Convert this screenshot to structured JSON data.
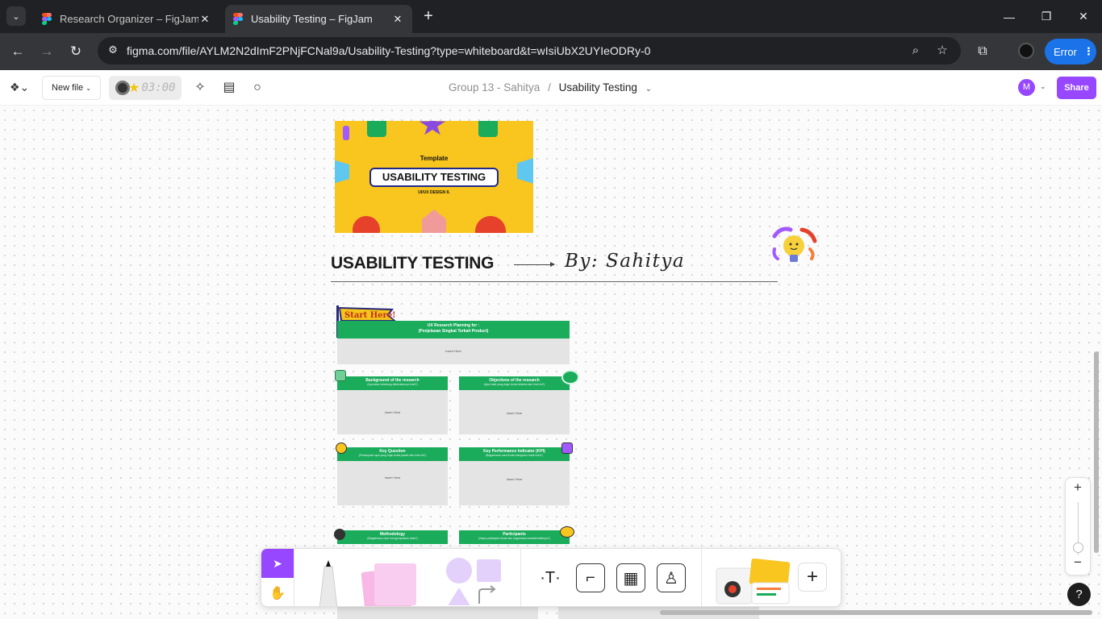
{
  "browser": {
    "tabs": [
      {
        "title": "Research Organizer – FigJam",
        "active": false
      },
      {
        "title": "Usability Testing – FigJam",
        "active": true
      }
    ],
    "url": "figma.com/file/AYLM2N2dImF2PNjFCNal9a/Usability-Testing?type=whiteboard&t=wIsiUbX2UYIeODRy-0",
    "error_label": "Error"
  },
  "header": {
    "new_file_label": "New file",
    "timer": "03:00",
    "team": "Group 13 - Sahitya",
    "separator": "/",
    "file_name": "Usability Testing",
    "user_initial": "M",
    "share_label": "Share"
  },
  "board": {
    "cover": {
      "template_label": "Template",
      "title": "USABILITY TESTING",
      "subtitle": "UI/UX DESIGN II."
    },
    "heading": "USABILITY TESTING",
    "byline": "By: Sahitya",
    "flag_label": "Start Here!",
    "planning": {
      "title_line1": "UX Research Planning for :",
      "title_line2": "(Penjelasan Singkat Terkait Product)",
      "placeholder": "Insert Here"
    },
    "cards": [
      {
        "title": "Background of the research",
        "subtitle": "(Apa latar belakang dilakukannya riset?)",
        "placeholder": "Insert Here"
      },
      {
        "title": "Objectives of the research",
        "subtitle": "(Apa hasil yang ingin Anda ketahui dari riset ini?)",
        "placeholder": "Insert Here"
      },
      {
        "title": "Key Question",
        "subtitle": "(Pertanyaan apa yang ingin Anda jawab dari riset ini?)",
        "placeholder": "Insert Here"
      },
      {
        "title": "Key Performance Indicator (KPI)",
        "subtitle": "(Bagaimana cara Anda mengukur hasil riset?)",
        "placeholder": "Insert Here"
      },
      {
        "title": "Methodology",
        "subtitle": "(Bagaimana cara mengumpulkan data?)"
      },
      {
        "title": "Participants",
        "subtitle": "(Siapa partisipan Anda dan bagaimana karakteristiknya?)"
      }
    ]
  },
  "zoom": {
    "in": "+",
    "out": "−"
  },
  "help_label": "?",
  "colors": {
    "accent": "#9747ff",
    "green": "#1aab5b",
    "cover_yellow": "#f9c51f",
    "chrome_dark": "#202124"
  }
}
